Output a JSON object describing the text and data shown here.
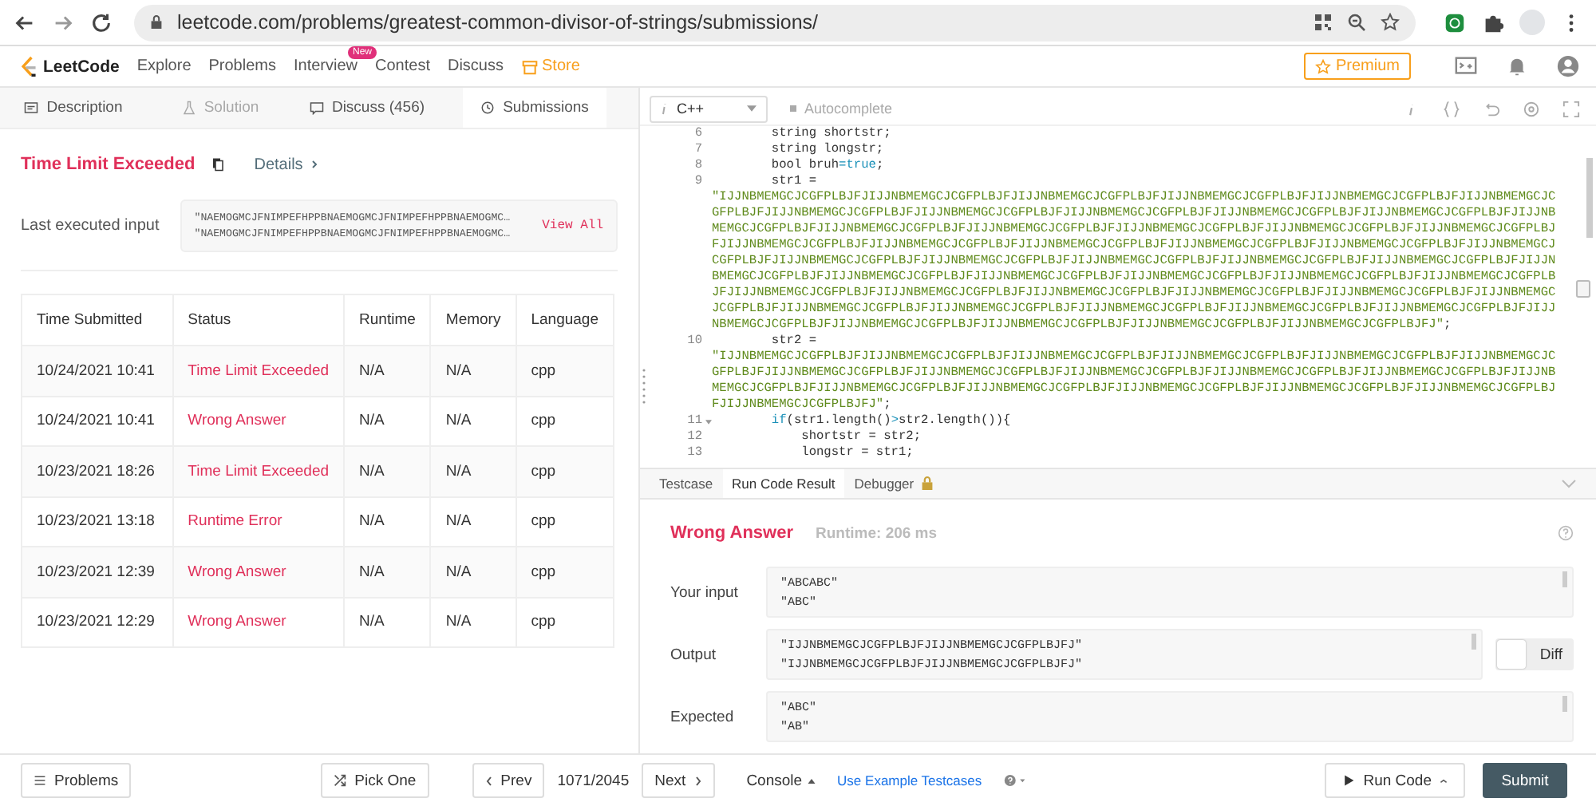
{
  "browser": {
    "url": "leetcode.com/problems/greatest-common-divisor-of-strings/submissions/"
  },
  "nav": {
    "logo": "LeetCode",
    "links": [
      {
        "label": "Explore",
        "kind": "plain"
      },
      {
        "label": "Problems",
        "kind": "plain"
      },
      {
        "label": "Interview",
        "kind": "plain",
        "badge": "New"
      },
      {
        "label": "Contest",
        "kind": "plain"
      },
      {
        "label": "Discuss",
        "kind": "plain"
      },
      {
        "label": "Store",
        "kind": "store"
      }
    ],
    "premium": "Premium"
  },
  "left_tabs": [
    {
      "label": "Description",
      "kind": "doc",
      "selected": false,
      "disabled": false
    },
    {
      "label": "Solution",
      "kind": "flask",
      "selected": false,
      "disabled": true
    },
    {
      "label": "Discuss (456)",
      "kind": "chat",
      "selected": false,
      "disabled": false
    },
    {
      "label": "Submissions",
      "kind": "clock",
      "selected": true,
      "disabled": false
    }
  ],
  "submission": {
    "status": "Time Limit Exceeded",
    "details": "Details",
    "input_label": "Last executed input",
    "input_lines": [
      "\"NAEMOGMCJFNIMPEFHPPBNAEMOGMCJFNIMPEFHPPBNAEMOGMC…",
      "\"NAEMOGMCJFNIMPEFHPPBNAEMOGMCJFNIMPEFHPPBNAEMOGMC…"
    ],
    "view_all": "View All"
  },
  "table": {
    "columns": [
      "Time Submitted",
      "Status",
      "Runtime",
      "Memory",
      "Language"
    ],
    "rows": [
      {
        "time": "10/24/2021 10:41",
        "status": "Time Limit Exceeded",
        "runtime": "N/A",
        "memory": "N/A",
        "language": "cpp"
      },
      {
        "time": "10/24/2021 10:41",
        "status": "Wrong Answer",
        "runtime": "N/A",
        "memory": "N/A",
        "language": "cpp"
      },
      {
        "time": "10/23/2021 18:26",
        "status": "Time Limit Exceeded",
        "runtime": "N/A",
        "memory": "N/A",
        "language": "cpp"
      },
      {
        "time": "10/23/2021 13:18",
        "status": "Runtime Error",
        "runtime": "N/A",
        "memory": "N/A",
        "language": "cpp"
      },
      {
        "time": "10/23/2021 12:39",
        "status": "Wrong Answer",
        "runtime": "N/A",
        "memory": "N/A",
        "language": "cpp"
      },
      {
        "time": "10/23/2021 12:29",
        "status": "Wrong Answer",
        "runtime": "N/A",
        "memory": "N/A",
        "language": "cpp"
      }
    ]
  },
  "editor": {
    "language": "C++",
    "autocomplete": "Autocomplete",
    "lines": [
      {
        "number": "6",
        "tokens": [
          {
            "text": "        string shortstr;",
            "kind": "plain"
          }
        ]
      },
      {
        "number": "7",
        "tokens": [
          {
            "text": "        string longstr;",
            "kind": "plain"
          }
        ]
      },
      {
        "number": "8",
        "tokens": [
          {
            "text": "        bool bruh",
            "kind": "plain"
          },
          {
            "text": "=true",
            "kind": "keyword"
          },
          {
            "text": ";",
            "kind": "plain"
          }
        ]
      },
      {
        "number": "9",
        "tokens": [
          {
            "text": "        str1 =",
            "kind": "plain"
          }
        ]
      },
      {
        "tokens": [
          {
            "text": "\"IJJNBMEMGCJCGFPLBJFJIJJNBMEMGCJCGFPLBJFJIJJNBMEMGCJCGFPLBJFJIJJNBMEMGCJCGFPLBJFJIJJNBMEMGCJCGFPLBJFJIJJNBMEMGCJC",
            "kind": "string"
          }
        ]
      },
      {
        "tokens": [
          {
            "text": "GFPLBJFJIJJNBMEMGCJCGFPLBJFJIJJNBMEMGCJCGFPLBJFJIJJNBMEMGCJCGFPLBJFJIJJNBMEMGCJCGFPLBJFJIJJNBMEMGCJCGFPLBJFJIJJNB",
            "kind": "string"
          }
        ]
      },
      {
        "tokens": [
          {
            "text": "MEMGCJCGFPLBJFJIJJNBMEMGCJCGFPLBJFJIJJNBMEMGCJCGFPLBJFJIJJNBMEMGCJCGFPLBJFJIJJNBMEMGCJCGFPLBJFJIJJNBMEMGCJCGFPLBJ",
            "kind": "string"
          }
        ]
      },
      {
        "tokens": [
          {
            "text": "FJIJJNBMEMGCJCGFPLBJFJIJJNBMEMGCJCGFPLBJFJIJJNBMEMGCJCGFPLBJFJIJJNBMEMGCJCGFPLBJFJIJJNBMEMGCJCGFPLBJFJIJJNBMEMGCJ",
            "kind": "string"
          }
        ]
      },
      {
        "tokens": [
          {
            "text": "CGFPLBJFJIJJNBMEMGCJCGFPLBJFJIJJNBMEMGCJCGFPLBJFJIJJNBMEMGCJCGFPLBJFJIJJNBMEMGCJCGFPLBJFJIJJNBMEMGCJCGFPLBJFJIJJN",
            "kind": "string"
          }
        ]
      },
      {
        "tokens": [
          {
            "text": "BMEMGCJCGFPLBJFJIJJNBMEMGCJCGFPLBJFJIJJNBMEMGCJCGFPLBJFJIJJNBMEMGCJCGFPLBJFJIJJNBMEMGCJCGFPLBJFJIJJNBMEMGCJCGFPLB",
            "kind": "string"
          }
        ]
      },
      {
        "tokens": [
          {
            "text": "JFJIJJNBMEMGCJCGFPLBJFJIJJNBMEMGCJCGFPLBJFJIJJNBMEMGCJCGFPLBJFJIJJNBMEMGCJCGFPLBJFJIJJNBMEMGCJCGFPLBJFJIJJNBMEMGC",
            "kind": "string"
          }
        ]
      },
      {
        "tokens": [
          {
            "text": "JCGFPLBJFJIJJNBMEMGCJCGFPLBJFJIJJNBMEMGCJCGFPLBJFJIJJNBMEMGCJCGFPLBJFJIJJNBMEMGCJCGFPLBJFJIJJNBMEMGCJCGFPLBJFJIJJ",
            "kind": "string"
          }
        ]
      },
      {
        "tokens": [
          {
            "text": "NBMEMGCJCGFPLBJFJIJJNBMEMGCJCGFPLBJFJIJJNBMEMGCJCGFPLBJFJIJJNBMEMGCJCGFPLBJFJIJJNBMEMGCJCGFPLBJFJ\"",
            "kind": "string"
          },
          {
            "text": ";",
            "kind": "plain"
          }
        ]
      },
      {
        "number": "10",
        "tokens": [
          {
            "text": "        str2 =",
            "kind": "plain"
          }
        ]
      },
      {
        "tokens": [
          {
            "text": "\"IJJNBMEMGCJCGFPLBJFJIJJNBMEMGCJCGFPLBJFJIJJNBMEMGCJCGFPLBJFJIJJNBMEMGCJCGFPLBJFJIJJNBMEMGCJCGFPLBJFJIJJNBMEMGCJC",
            "kind": "string"
          }
        ]
      },
      {
        "tokens": [
          {
            "text": "GFPLBJFJIJJNBMEMGCJCGFPLBJFJIJJNBMEMGCJCGFPLBJFJIJJNBMEMGCJCGFPLBJFJIJJNBMEMGCJCGFPLBJFJIJJNBMEMGCJCGFPLBJFJIJJNB",
            "kind": "string"
          }
        ]
      },
      {
        "tokens": [
          {
            "text": "MEMGCJCGFPLBJFJIJJNBMEMGCJCGFPLBJFJIJJNBMEMGCJCGFPLBJFJIJJNBMEMGCJCGFPLBJFJIJJNBMEMGCJCGFPLBJFJIJJNBMEMGCJCGFPLBJ",
            "kind": "string"
          }
        ]
      },
      {
        "tokens": [
          {
            "text": "FJIJJNBMEMGCJCGFPLBJFJ\"",
            "kind": "string"
          },
          {
            "text": ";",
            "kind": "plain"
          }
        ]
      },
      {
        "number": "11",
        "fold": true,
        "tokens": [
          {
            "text": "        if",
            "kind": "keyword"
          },
          {
            "text": "(str1.length()",
            "kind": "plain"
          },
          {
            "text": ">",
            "kind": "keyword"
          },
          {
            "text": "str2.length()){",
            "kind": "plain"
          }
        ]
      },
      {
        "number": "12",
        "tokens": [
          {
            "text": "            shortstr = str2;",
            "kind": "plain"
          }
        ]
      },
      {
        "number": "13",
        "tokens": [
          {
            "text": "            longstr = str1;",
            "kind": "plain"
          }
        ]
      }
    ]
  },
  "console": {
    "tabs": [
      {
        "label": "Testcase",
        "selected": false,
        "locked": false
      },
      {
        "label": "Run Code Result",
        "selected": true,
        "locked": false
      },
      {
        "label": "Debugger",
        "selected": false,
        "locked": true
      }
    ],
    "result": "Wrong Answer",
    "runtime": "Runtime: 206 ms",
    "fields": [
      {
        "label": "Your input",
        "lines": [
          "\"ABCABC\"",
          "\"ABC\""
        ]
      },
      {
        "label": "Output",
        "lines": [
          "\"IJJNBMEMGCJCGFPLBJFJIJJNBMEMGCJCGFPLBJFJ\"",
          "\"IJJNBMEMGCJCGFPLBJFJIJJNBMEMGCJCGFPLBJFJ\""
        ],
        "diff": {
          "label": "Diff",
          "on": false
        }
      },
      {
        "label": "Expected",
        "lines": [
          "\"ABC\"",
          "\"AB\""
        ]
      }
    ]
  },
  "bottom": {
    "problems": "Problems",
    "pick_one": "Pick One",
    "prev": "Prev",
    "page": "1071/2045",
    "next": "Next",
    "console": "Console",
    "use_example": "Use Example Testcases",
    "run_code": "Run Code",
    "submit": "Submit"
  }
}
